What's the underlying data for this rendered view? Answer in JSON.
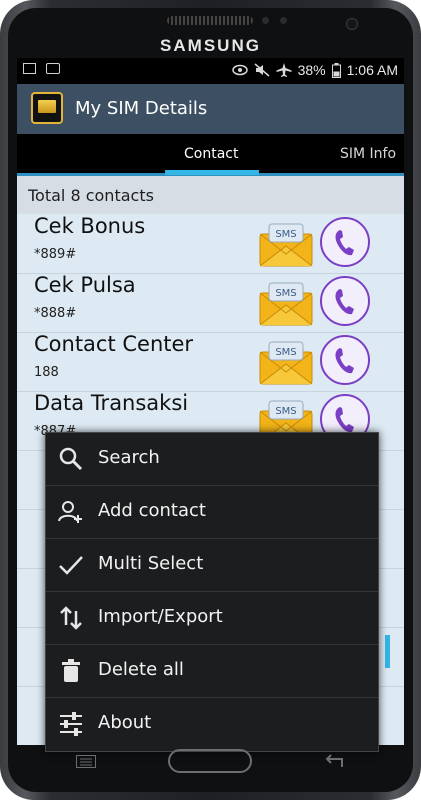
{
  "device": {
    "brand": "SAMSUNG"
  },
  "status_bar": {
    "battery": "38%",
    "time": "1:06 AM"
  },
  "app": {
    "title": "My SIM Details"
  },
  "tabs": [
    {
      "label": "Contact",
      "active": true
    },
    {
      "label": "SIM Info",
      "active": false
    }
  ],
  "summary": {
    "total_text": "Total 8 contacts"
  },
  "contacts": [
    {
      "name": "Cek Bonus",
      "number": "*889#"
    },
    {
      "name": "Cek Pulsa",
      "number": "*888#"
    },
    {
      "name": "Contact Center",
      "number": "188"
    },
    {
      "name": "Data Transaksi",
      "number": "*887#"
    }
  ],
  "sms_icon_text": "SMS",
  "menu": {
    "items": [
      {
        "label": "Search",
        "icon": "search-icon"
      },
      {
        "label": "Add contact",
        "icon": "add-contact-icon"
      },
      {
        "label": "Multi Select",
        "icon": "checkmark-icon"
      },
      {
        "label": "Import/Export",
        "icon": "import-export-icon"
      },
      {
        "label": "Delete all",
        "icon": "trash-icon"
      },
      {
        "label": "About",
        "icon": "sliders-icon"
      }
    ]
  },
  "colors": {
    "action_bar": "#3d4f62",
    "tab_indicator": "#33b5e5",
    "call_ring": "#7b3fc5",
    "list_bg": "#ddeaf3"
  }
}
